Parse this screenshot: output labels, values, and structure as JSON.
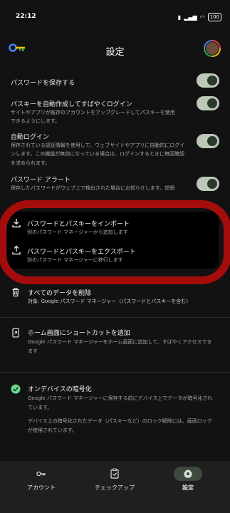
{
  "status_bar": {
    "time": "22:12",
    "battery": "100"
  },
  "header": {
    "title": "設定"
  },
  "settings": {
    "save_passwords": {
      "title": "パスワードを保存する",
      "enabled": true
    },
    "passkey_auto": {
      "title": "パスキーを自動作成してすばやくログイン",
      "desc_lines": [
        "サイトやアプリが既存のアカウントをアップグレードしてパスキーを使用",
        "できるようにします。"
      ],
      "enabled": true
    },
    "auto_signin": {
      "title": "自動ログイン",
      "desc_lines": [
        "保存されている認証情報を使用して、ウェブサイトやアプリに自動的にログイ",
        "ンします。この機能が無効になっている場合は、ログインするときに毎回確認",
        "を求められます。"
      ],
      "enabled": true
    },
    "password_alert": {
      "title": "パスワード アラート",
      "desc": "保存したパスワードがウェブ上で検出された場合にお知らせします。詳細",
      "enabled": true
    }
  },
  "import_export": {
    "import": {
      "title": "パスワードとパスキーをインポート",
      "sub": "別のパスワード マネージャーから追加します"
    },
    "export": {
      "title": "パスワードとパスキーをエクスポート",
      "sub": "別のパスワード マネージャーに移行します"
    }
  },
  "delete_all": {
    "title": "すべてのデータを削除",
    "sub": "対象: Google パスワード マネージャー（パスワードとパスキーを含む）"
  },
  "shortcut": {
    "title": "ホーム画面にショートカットを追加",
    "desc_lines": [
      "Google パスワード マネージャーをホーム画面に追加して、すばやくアクセスでき",
      "ます"
    ]
  },
  "encryption": {
    "title": "オンデバイスの暗号化",
    "desc_lines": [
      "Google パスワード マネージャーに保存する前にデバイス上でデータが暗号化され",
      "ています。"
    ],
    "desc2_lines": [
      "デバイス上の暗号化されたデータ（パスキーなど）のロック解除には、画面ロック",
      "が使用されています。"
    ],
    "status_color": "#6dd58c"
  },
  "bottom_nav": {
    "items": [
      {
        "label": "アカウント",
        "icon": "key-icon"
      },
      {
        "label": "チェックアップ",
        "icon": "clipboard-check-icon"
      },
      {
        "label": "設定",
        "icon": "gear-icon",
        "active": true
      }
    ]
  },
  "colors": {
    "highlight": "#a50c0c",
    "toggle_track": "#bcc8b8",
    "background": "#121212"
  }
}
